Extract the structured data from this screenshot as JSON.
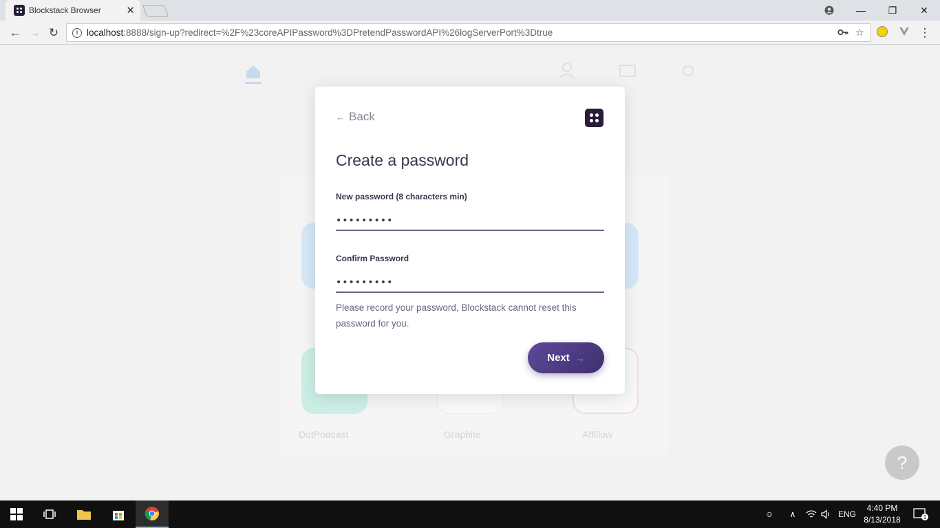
{
  "browser": {
    "tab_title": "Blockstack Browser",
    "tab_close": "✕",
    "url_host": "localhost",
    "url_rest": ":8888/sign-up?redirect=%2F%23coreAPIPassword%3DPretendPasswordAPI%26logServerPort%3Dtrue",
    "back_icon": "←",
    "forward_icon": "→",
    "reload_icon": "↻",
    "menu_icon": "⋮"
  },
  "window_controls": {
    "minimize": "—",
    "restore": "❐",
    "close": "✕"
  },
  "page_bg": {
    "tile_labels": [
      "DotPodcast",
      "Graphite",
      "Afflilow"
    ]
  },
  "dialog": {
    "back_label": "Back",
    "title": "Create a password",
    "new_password_label": "New password (8 characters min)",
    "new_password_value": "•••••••••",
    "confirm_password_label": "Confirm Password",
    "confirm_password_value": "•••••••••",
    "note": "Please record your password, Blockstack cannot reset this password for you.",
    "next_label": "Next"
  },
  "help_button": "?",
  "taskbar": {
    "language": "ENG",
    "time": "4:40 PM",
    "date": "8/13/2018",
    "notification_count": "1"
  }
}
